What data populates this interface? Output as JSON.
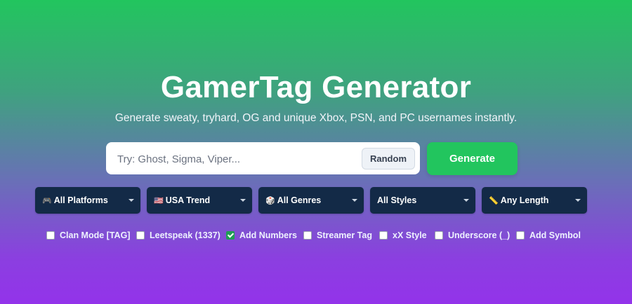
{
  "hero": {
    "title": "GamerTag Generator",
    "subtitle": "Generate sweaty, tryhard, OG and unique Xbox, PSN, and PC usernames instantly."
  },
  "search": {
    "placeholder": "Try: Ghost, Sigma, Viper...",
    "value": "",
    "random_label": "Random",
    "generate_label": "Generate"
  },
  "selects": [
    {
      "icon": "🎮",
      "icon_name": "gamepad-icon",
      "value": "All Platforms"
    },
    {
      "icon": "🇺🇸",
      "icon_name": "us-flag-icon",
      "value": "USA Trend"
    },
    {
      "icon": "🎲",
      "icon_name": "dice-icon",
      "value": "All Genres"
    },
    {
      "icon": "",
      "icon_name": "",
      "value": "All Styles"
    },
    {
      "icon": "📏",
      "icon_name": "ruler-icon",
      "value": "Any Length"
    }
  ],
  "options": [
    {
      "label": "Clan Mode [TAG]",
      "checked": false
    },
    {
      "label": "Leetspeak (1337)",
      "checked": false
    },
    {
      "label": "Add Numbers",
      "checked": true
    },
    {
      "label": "Streamer Tag",
      "checked": false
    },
    {
      "label": "xX Style",
      "checked": false
    },
    {
      "label": "Underscore (_)",
      "checked": false
    },
    {
      "label": "Add Symbol",
      "checked": false
    }
  ],
  "colors": {
    "accent_green": "#22c55e",
    "select_bg": "#132a47",
    "gradient_top": "#22c55e",
    "gradient_bottom": "#9333ea"
  }
}
